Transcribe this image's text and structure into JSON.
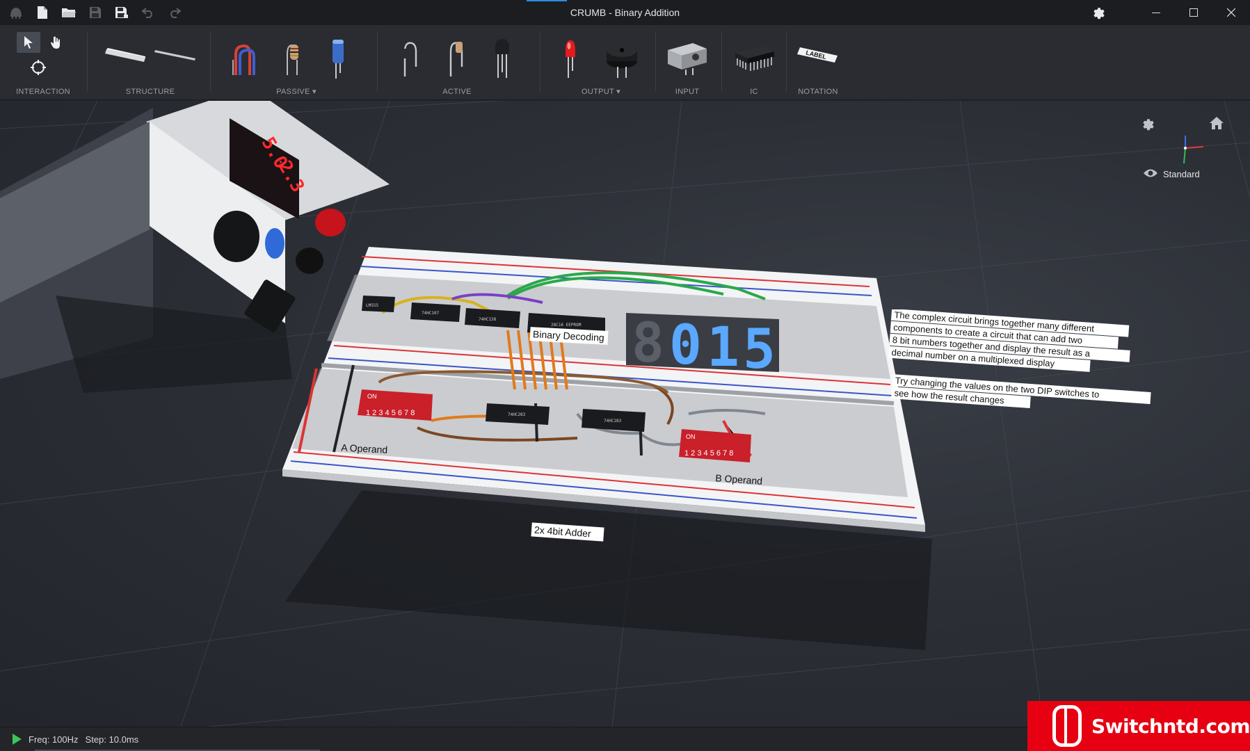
{
  "window": {
    "title": "CRUMB - Binary Addition"
  },
  "toolbar": {
    "groups": [
      {
        "id": "interaction",
        "label": "INTERACTION"
      },
      {
        "id": "structure",
        "label": "STRUCTURE"
      },
      {
        "id": "passive",
        "label": "PASSIVE",
        "has_dropdown": true
      },
      {
        "id": "active",
        "label": "ACTIVE"
      },
      {
        "id": "output",
        "label": "OUTPUT",
        "has_dropdown": true
      },
      {
        "id": "input",
        "label": "INPUT"
      },
      {
        "id": "ic",
        "label": "IC"
      },
      {
        "id": "notation",
        "label": "NOTATION"
      }
    ],
    "notation_icon_text": "LABEL"
  },
  "view": {
    "mode_label": "Standard"
  },
  "scene": {
    "psu_voltage": "5.0",
    "psu_current": "2.3",
    "display_digits": [
      "8",
      "0",
      "1",
      "5"
    ],
    "labels": {
      "binary_decoding": "Binary Decoding",
      "a_operand": "A Operand",
      "b_operand": "B Operand",
      "adder": "2x 4bit Adder",
      "dip_on": "ON",
      "dip_numbers": "1 2 3 4 5 6 7 8"
    },
    "chips": {
      "timer": "LM555",
      "counter": "74HC107",
      "decoder": "74HC138",
      "eeprom": "28C16 EEPROM",
      "adder1": "74HC283",
      "adder2": "74HC283"
    },
    "note1": [
      "The complex circuit brings together many different",
      "components to create a circuit that can add two",
      "8 bit numbers together and display the result as a",
      "decimal number on a multiplexed display"
    ],
    "note2": [
      "Try changing the values on the two DIP switches to",
      "see how the result changes"
    ]
  },
  "status": {
    "freq": "Freq: 100Hz",
    "step": "Step: 10.0ms"
  },
  "watermark": {
    "text": "Switchntd.com"
  },
  "colors": {
    "accent": "#2f8ae6",
    "play": "#3fc25a",
    "watermark_bg": "#e60012",
    "led_blue": "#5aa8ff",
    "psu_red": "#ff2a2a"
  }
}
